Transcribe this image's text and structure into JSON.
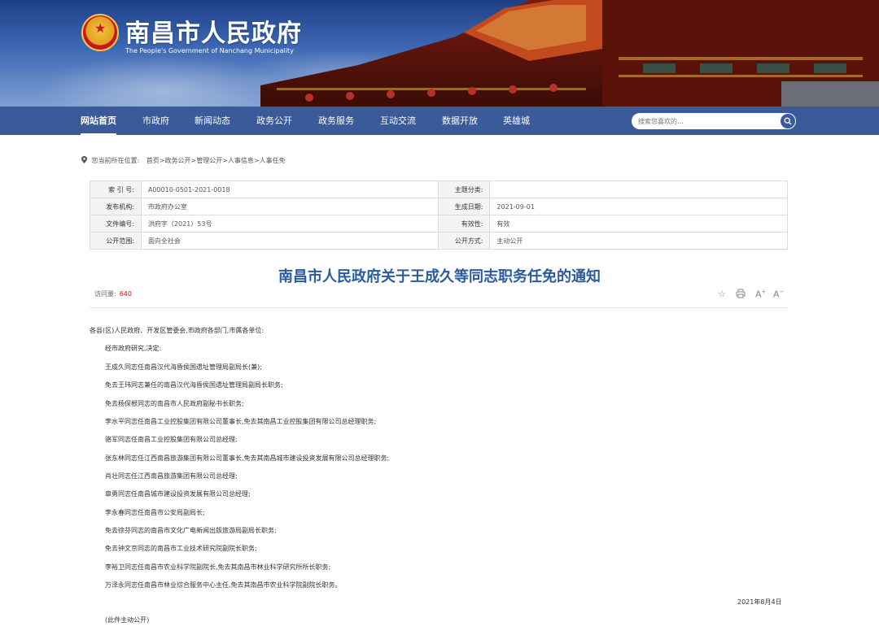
{
  "header": {
    "site_title": "南昌市人民政府",
    "site_subtitle": "The People's Government of Nanchang Municipality"
  },
  "nav": {
    "items": [
      {
        "label": "网站首页",
        "active": true
      },
      {
        "label": "市政府"
      },
      {
        "label": "新闻动态"
      },
      {
        "label": "政务公开"
      },
      {
        "label": "政务服务"
      },
      {
        "label": "互动交流"
      },
      {
        "label": "数据开放"
      },
      {
        "label": "英雄城"
      }
    ],
    "search_placeholder": "搜索您喜欢的..."
  },
  "breadcrumb": {
    "prefix": "您当前所在位置:",
    "path": "首页>政务公开>管理公开>人事信息>人事任免"
  },
  "meta": {
    "rows": [
      {
        "l1": "索 引 号:",
        "v1": "A00010-0501-2021-0018",
        "l2": "主题分类:",
        "v2": ""
      },
      {
        "l1": "发布机构:",
        "v1": "市政府办公室",
        "l2": "生成日期:",
        "v2": "2021-09-01"
      },
      {
        "l1": "文件编号:",
        "v1": "洪府字（2021）53号",
        "l2": "有效性:",
        "v2": "有效"
      },
      {
        "l1": "公开范围:",
        "v1": "面向全社会",
        "l2": "公开方式:",
        "v2": "主动公开"
      }
    ]
  },
  "document": {
    "title": "南昌市人民政府关于王成久等同志职务任免的通知",
    "views_label": "访问量:",
    "views_count": "640",
    "tools": [
      "star-icon",
      "print-icon",
      "font-larger-icon",
      "font-smaller-icon"
    ],
    "salutation": "各县(区)人民政府、开发区管委会,市政府各部门,市属各单位:",
    "paragraphs": [
      "经市政府研究,决定:",
      "王成久同志任南昌汉代海昏侯国遗址管理局副局长(兼);",
      "免去王玮同志兼任的南昌汉代海昏侯国遗址管理局副局长职务;",
      "免去杨保根同志的南昌市人民政府副秘书长职务;",
      "李水平同志任南昌工业控股集团有限公司董事长,免去其南昌工业控股集团有限公司总经理职务;",
      "骆军同志任南昌工业控股集团有限公司总经理;",
      "张东林同志任江西南昌旅游集团有限公司董事长,免去其南昌城市建设投资发展有限公司总经理职务;",
      "肖壮同志任江西南昌旅游集团有限公司总经理;",
      "章勇同志任南昌城市建设投资发展有限公司总经理;",
      "李永春同志任南昌市公安局副局长;",
      "免去徐芬同志的南昌市文化广电新闻出版旅游局副局长职务;",
      "免去钟文京同志的南昌市工业技术研究院副院长职务;",
      "李裕卫同志任南昌市农业科学院副院长,免去其南昌市林业科学研究所所长职务;",
      "万泽永同志任南昌市林业综合服务中心主任,免去其南昌市农业科学院副院长职务。"
    ],
    "date": "2021年8月4日",
    "note": "(此件主动公开)"
  }
}
